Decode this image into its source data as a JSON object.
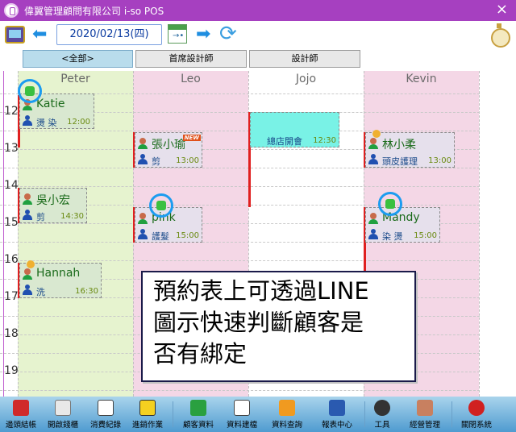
{
  "window": {
    "title": "偉翼管理顧問有限公司 i-so POS",
    "close": "×"
  },
  "toolbar": {
    "date": "2020/02/13(四)",
    "prev": "⬅",
    "next": "➡",
    "refresh": "⟳",
    "cal": "→•"
  },
  "tabs": [
    "<全部>",
    "首席設計師",
    "設計師"
  ],
  "staff": [
    "Peter",
    "Leo",
    "Jojo",
    "Kevin"
  ],
  "hours": [
    "12",
    "13",
    "14",
    "15",
    "16",
    "17",
    "18",
    "19"
  ],
  "appointments": [
    {
      "customer": "Katie",
      "service": "燙 染",
      "time": "12:00"
    },
    {
      "customer": "張小瑜",
      "service": "剪",
      "time": "13:00",
      "badge": "NEW"
    },
    {
      "customer": "總店開會",
      "service": "",
      "time": "12:30"
    },
    {
      "customer": "林小柔",
      "service": "頭皮護理",
      "time": "13:00"
    },
    {
      "customer": "吳小宏",
      "service": "剪",
      "time": "14:30"
    },
    {
      "customer": "pink",
      "service": "護髮",
      "time": "15:00"
    },
    {
      "customer": "Mandy",
      "service": "染 燙",
      "time": "15:00"
    },
    {
      "customer": "Hannah",
      "service": "洗",
      "time": "16:30"
    }
  ],
  "callout": "預約表上可透過LINE\n圖示快速判斷顧客是\n否有綁定",
  "colors": {
    "title_bar": "#a640c0",
    "peter_col": "#e6f3cf",
    "leo_col": "#f4d7e6",
    "jojo_col": "#fff",
    "kevin_col": "#f4d7e6",
    "accent": "#1c9cf0"
  },
  "bottom": [
    {
      "label": "邊頭結帳",
      "icon": "cart-icon"
    },
    {
      "label": "開啟錢櫃",
      "icon": "register-icon"
    },
    {
      "label": "消費紀錄",
      "icon": "receipt-icon"
    },
    {
      "label": "進銷作業",
      "icon": "inventory-icon"
    },
    {
      "label": "顧客資料",
      "icon": "customer-icon"
    },
    {
      "label": "資料建檔",
      "icon": "file-icon"
    },
    {
      "label": "資料查詢",
      "icon": "search-icon"
    },
    {
      "label": "報表中心",
      "icon": "report-icon"
    },
    {
      "label": "工具",
      "icon": "gear-icon"
    },
    {
      "label": "經營管理",
      "icon": "management-icon"
    },
    {
      "label": "關閉系統",
      "icon": "power-icon"
    }
  ]
}
